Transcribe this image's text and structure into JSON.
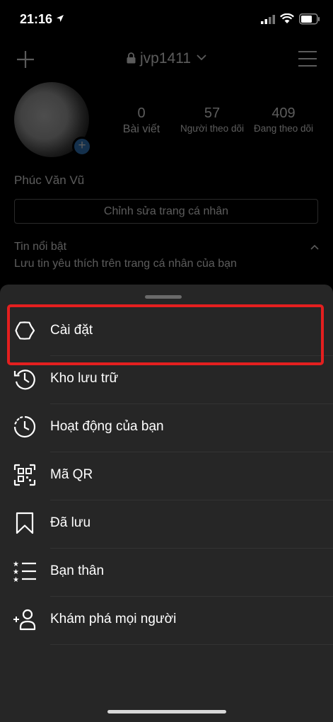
{
  "status_bar": {
    "time": "21:16"
  },
  "profile": {
    "username": "jvp1411",
    "display_name": "Phúc Văn Vũ",
    "stats": [
      {
        "value": "0",
        "label": "Bài viết"
      },
      {
        "value": "57",
        "label": "Người theo dõi"
      },
      {
        "value": "409",
        "label": "Đang theo dõi"
      }
    ],
    "edit_profile_label": "Chỉnh sửa trang cá nhân",
    "highlights": {
      "title": "Tin nổi bật",
      "description": "Lưu tin yêu thích trên trang cá nhân của bạn"
    }
  },
  "sheet": {
    "items": [
      {
        "label": "Cài đặt",
        "icon": "settings-gear-icon"
      },
      {
        "label": "Kho lưu trữ",
        "icon": "archive-history-icon"
      },
      {
        "label": "Hoạt động của bạn",
        "icon": "activity-clock-icon"
      },
      {
        "label": "Mã QR",
        "icon": "qr-code-icon"
      },
      {
        "label": "Đã lưu",
        "icon": "bookmark-icon"
      },
      {
        "label": "Bạn thân",
        "icon": "close-friends-list-icon"
      },
      {
        "label": "Khám phá mọi người",
        "icon": "add-person-icon"
      }
    ]
  },
  "colors": {
    "sheet_background": "#262626",
    "highlight_border": "#e41f1f",
    "avatar_badge": "#3a87d6"
  }
}
